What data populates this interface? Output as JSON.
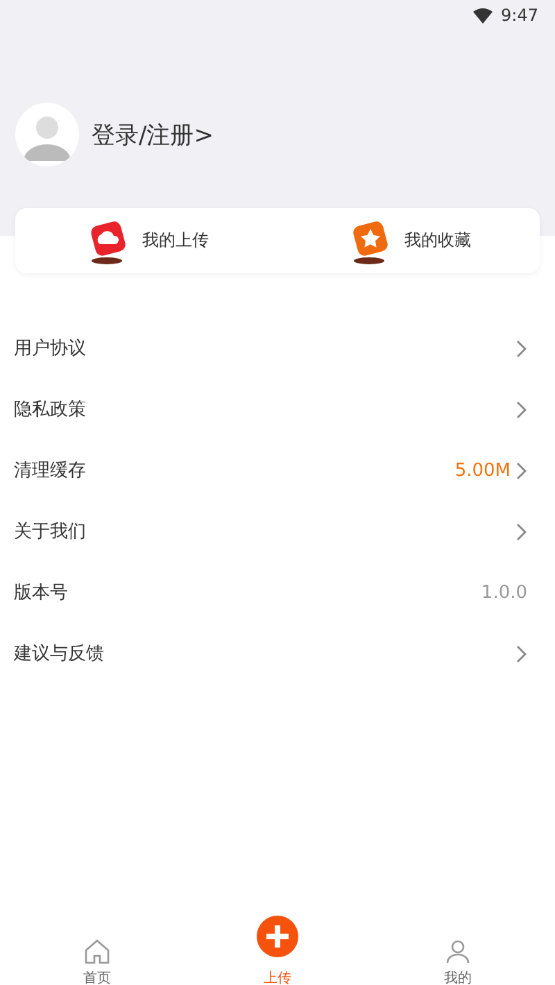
{
  "status_bar": {
    "time": "9:47"
  },
  "profile": {
    "login_label": "登录/注册>"
  },
  "shortcuts": [
    {
      "label": "我的上传",
      "kind": "upload"
    },
    {
      "label": "我的收藏",
      "kind": "favorite"
    }
  ],
  "menu": [
    {
      "label": "用户协议",
      "kind": "link"
    },
    {
      "label": "隐私政策",
      "kind": "link"
    },
    {
      "label": "清理缓存",
      "kind": "highlight",
      "value": "5.00M"
    },
    {
      "label": "关于我们",
      "kind": "link"
    },
    {
      "label": "版本号",
      "kind": "info",
      "value": "1.0.0"
    },
    {
      "label": "建议与反馈",
      "kind": "link"
    }
  ],
  "tabs": [
    {
      "label": "首页",
      "kind": "home",
      "selected": false
    },
    {
      "label": "上传",
      "kind": "upload",
      "selected": true
    },
    {
      "label": "我的",
      "kind": "me",
      "selected": false
    }
  ]
}
